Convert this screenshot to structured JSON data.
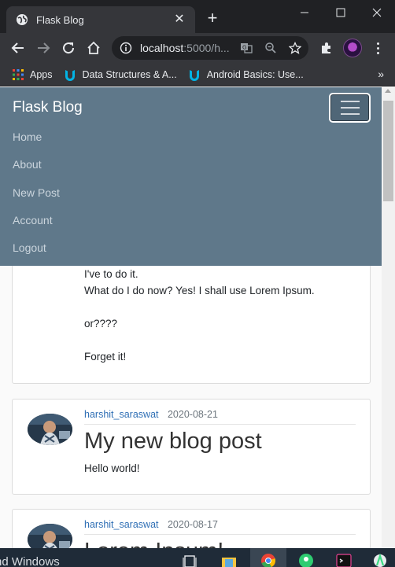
{
  "browser": {
    "tab_title": "Flask Blog",
    "url_host": "localhost",
    "url_rest": ":5000/h...",
    "bookmarks": [
      {
        "label": "Apps",
        "icon": "apps-grid-icon"
      },
      {
        "label": "Data Structures & A...",
        "icon": "udacity-icon"
      },
      {
        "label": "Android Basics: Use...",
        "icon": "udacity-icon"
      }
    ],
    "more_bookmarks": "»"
  },
  "navbar": {
    "brand": "Flask Blog",
    "links": [
      "Home",
      "About",
      "New Post",
      "Account",
      "Logout"
    ]
  },
  "posts": [
    {
      "content_lines": [
        "I've to do it.",
        "What do I do now? Yes! I shall use Lorem Ipsum.",
        "",
        "or????",
        "",
        "Forget it!"
      ]
    },
    {
      "author": "harshit_saraswat",
      "date": "2020-08-21",
      "title": "My new blog post",
      "content": "Hello world!"
    },
    {
      "author": "harshit_saraswat",
      "date": "2020-08-17",
      "title": "Lorem Ipsum!"
    }
  ],
  "taskbar": {
    "search_text": "nd Windows"
  },
  "colors": {
    "navbar": "#5f788a",
    "link": "#2f6fb5",
    "chrome_dark": "#202124"
  }
}
